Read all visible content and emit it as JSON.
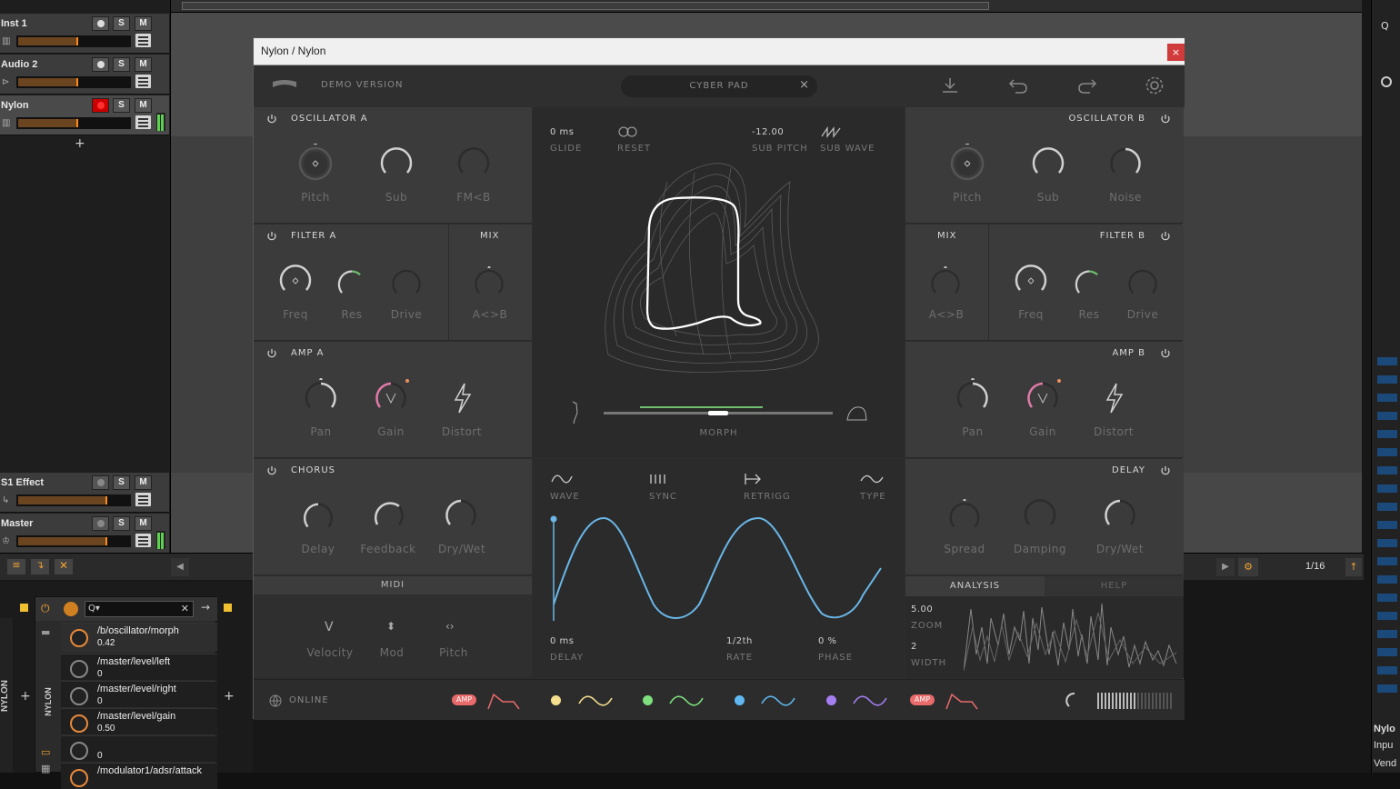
{
  "daw": {
    "tracks": [
      {
        "name": "Inst 1",
        "solo": "S",
        "mute": "M"
      },
      {
        "name": "Audio 2",
        "solo": "S",
        "mute": "M"
      },
      {
        "name": "Nylon",
        "solo": "S",
        "mute": "M"
      }
    ],
    "fx_tracks": [
      {
        "name": "S1 Effect",
        "solo": "S",
        "mute": "M"
      },
      {
        "name": "Master",
        "solo": "S",
        "mute": "M"
      }
    ],
    "add_track": "+",
    "grid": "1/16",
    "device_label": "NYLON",
    "side_label": "NYLON",
    "modulators": [
      {
        "path": "/b/oscillator/morph",
        "value": "0.42"
      },
      {
        "path": "/master/level/left",
        "value": "0"
      },
      {
        "path": "/master/level/right",
        "value": "0"
      },
      {
        "path": "/master/level/gain",
        "value": "0.50"
      },
      {
        "path": "",
        "value": "0"
      },
      {
        "path": "/modulator1/adsr/attack",
        "value": ""
      }
    ],
    "right_panel_labels": [
      "Nylo",
      "Inpu",
      "Vend"
    ]
  },
  "plugin": {
    "window_title": "Nylon / Nylon",
    "close": "×",
    "demo": "DEMO VERSION",
    "preset": "CYBER PAD",
    "preset_clear": "×",
    "osc_a": {
      "title": "OSCILLATOR A",
      "knobs": [
        "Pitch",
        "Sub",
        "FM<B"
      ]
    },
    "osc_b": {
      "title": "OSCILLATOR B",
      "knobs": [
        "Pitch",
        "Sub",
        "Noise"
      ]
    },
    "filter_a": {
      "title": "FILTER A",
      "knobs": [
        "Freq",
        "Res",
        "Drive"
      ]
    },
    "filter_b": {
      "title": "FILTER B",
      "knobs": [
        "Freq",
        "Res",
        "Drive"
      ]
    },
    "mix_a": {
      "title": "MIX",
      "knob": "A<>B"
    },
    "mix_b": {
      "title": "MIX",
      "knob": "A<>B"
    },
    "amp_a": {
      "title": "AMP A",
      "knobs": [
        "Pan",
        "Gain",
        "Distort"
      ]
    },
    "amp_b": {
      "title": "AMP B",
      "knobs": [
        "Pan",
        "Gain",
        "Distort"
      ]
    },
    "chorus": {
      "title": "CHORUS",
      "knobs": [
        "Delay",
        "Feedback",
        "Dry/Wet"
      ]
    },
    "delay": {
      "title": "DELAY",
      "knobs": [
        "Spread",
        "Damping",
        "Dry/Wet"
      ]
    },
    "morph": {
      "glide_value": "0 ms",
      "glide_label": "GLIDE",
      "reset_label": "RESET",
      "sub_pitch_value": "-12.00",
      "sub_pitch_label": "SUB PITCH",
      "sub_wave_label": "SUB WAVE",
      "morph_label": "MORPH",
      "morph_position": 0.5
    },
    "lfo": {
      "wave": "WAVE",
      "sync": "SYNC",
      "retrigg": "RETRIGG",
      "type": "TYPE",
      "delay_value": "0 ms",
      "delay_label": "DELAY",
      "rate_value": "1/2th",
      "rate_label": "RATE",
      "phase_value": "0 %",
      "phase_label": "PHASE"
    },
    "midi": {
      "title": "MIDI",
      "items": [
        "Velocity",
        "Mod",
        "Pitch"
      ]
    },
    "analysis": {
      "tab1": "ANALYSIS",
      "tab2": "HELP",
      "zoom_value": "5.00",
      "zoom_label": "ZOOM",
      "width_value": "2",
      "width_label": "WIDTH"
    },
    "footer": {
      "online": "ONLINE",
      "amp_badge": "AMP",
      "dot_colors": [
        "#f4df8f",
        "#7ee07e",
        "#5fb8f0",
        "#a57ff0"
      ],
      "amp_color": "#e86a6a"
    },
    "colors": {
      "lfo": "#6ab7e8",
      "morph_bar": "#6fbf6f",
      "gain": "#e07aa8"
    }
  }
}
